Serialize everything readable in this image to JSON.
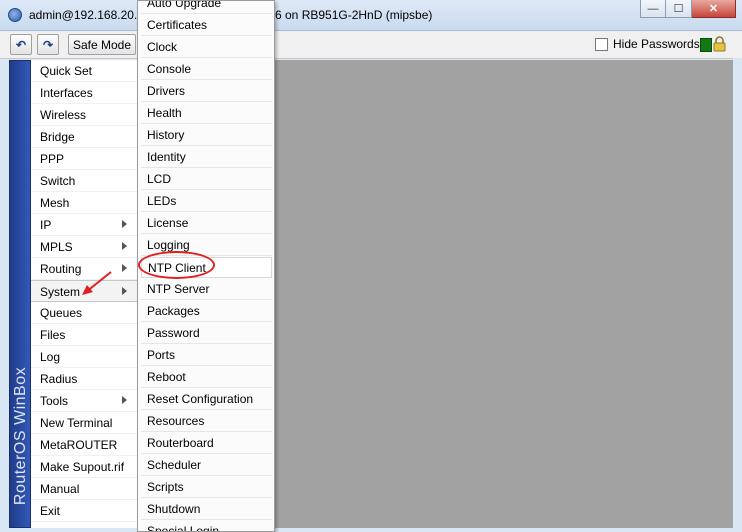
{
  "window": {
    "title_left": "admin@192.168.20.",
    "title_right": "6 on RB951G-2HnD (mipsbe)",
    "controls": {
      "minimize": "—",
      "maximize": "☐",
      "close": "✕"
    }
  },
  "toolbar": {
    "undo_glyph": "↶",
    "redo_glyph": "↷",
    "safe_mode_label": "Safe Mode",
    "hide_passwords_label": "Hide Passwords",
    "hide_passwords_checked": false,
    "status_color": "#137a13"
  },
  "sidebar": {
    "brand_label": "RouterOS WinBox",
    "items": [
      {
        "label": "Quick Set",
        "submenu": false
      },
      {
        "label": "Interfaces",
        "submenu": false
      },
      {
        "label": "Wireless",
        "submenu": false
      },
      {
        "label": "Bridge",
        "submenu": false
      },
      {
        "label": "PPP",
        "submenu": false
      },
      {
        "label": "Switch",
        "submenu": false
      },
      {
        "label": "Mesh",
        "submenu": false
      },
      {
        "label": "IP",
        "submenu": true
      },
      {
        "label": "MPLS",
        "submenu": true
      },
      {
        "label": "Routing",
        "submenu": true
      },
      {
        "label": "System",
        "submenu": true,
        "active": true
      },
      {
        "label": "Queues",
        "submenu": false
      },
      {
        "label": "Files",
        "submenu": false
      },
      {
        "label": "Log",
        "submenu": false
      },
      {
        "label": "Radius",
        "submenu": false
      },
      {
        "label": "Tools",
        "submenu": true
      },
      {
        "label": "New Terminal",
        "submenu": false
      },
      {
        "label": "MetaROUTER",
        "submenu": false
      },
      {
        "label": "Make Supout.rif",
        "submenu": false
      },
      {
        "label": "Manual",
        "submenu": false
      },
      {
        "label": "Exit",
        "submenu": false
      }
    ]
  },
  "system_submenu": {
    "items": [
      "Auto Upgrade",
      "Certificates",
      "Clock",
      "Console",
      "Drivers",
      "Health",
      "History",
      "Identity",
      "LCD",
      "LEDs",
      "License",
      "Logging",
      "NTP Client",
      "NTP Server",
      "Packages",
      "Password",
      "Ports",
      "Reboot",
      "Reset Configuration",
      "Resources",
      "Routerboard",
      "Scheduler",
      "Scripts",
      "Shutdown",
      "Special Login"
    ],
    "highlighted": "NTP Client"
  },
  "annotation": {
    "color": "#e02020"
  }
}
